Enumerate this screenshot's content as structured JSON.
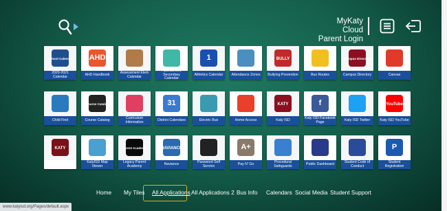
{
  "header": {
    "login_line1": "MyKaty Cloud",
    "login_line2": "Parent Login",
    "icons": [
      "search-icon",
      "hamburger-menu-icon",
      "logout-icon"
    ]
  },
  "tiles": [
    {
      "label": "2020-2021 Calendar",
      "art": "School Calendar",
      "color": "#1e4e8c"
    },
    {
      "label": "AHD Handbook",
      "art": "AHD",
      "color": "#e8572e"
    },
    {
      "label": "Assessment Elem Calendar",
      "art": "",
      "color": "#b07a4a"
    },
    {
      "label": "Assessment Secondary Calendar",
      "art": "",
      "color": "#3fb8a8"
    },
    {
      "label": "Athletics Calendar",
      "art": "1",
      "color": "#1a4fb0"
    },
    {
      "label": "Attendance Zones",
      "art": "",
      "color": "#4a8fc0"
    },
    {
      "label": "Bullying Prevention",
      "art": "BULLY",
      "color": "#c02a2a"
    },
    {
      "label": "Bus Routes",
      "art": "",
      "color": "#f0c020"
    },
    {
      "label": "Campus Directory",
      "art": "Campus Directory",
      "color": "#8a1020"
    },
    {
      "label": "Canvas",
      "art": "",
      "color": "#e03a2a"
    },
    {
      "label": "Child Find",
      "art": "",
      "color": "#2a7ac0"
    },
    {
      "label": "Course Catalog",
      "art": "Course Catalog",
      "color": "#222222"
    },
    {
      "label": "Curriculum Information",
      "art": "",
      "color": "#e04060"
    },
    {
      "label": "District Calendars",
      "art": "31",
      "color": "#3a7ad0"
    },
    {
      "label": "Electric Bus",
      "art": "",
      "color": "#3a9ab0"
    },
    {
      "label": "Home Access",
      "art": "",
      "color": "#e8402a"
    },
    {
      "label": "Katy ISD",
      "art": "KATY",
      "color": "#8a1020"
    },
    {
      "label": "Katy ISD Facebook Page",
      "art": "f",
      "color": "#3b5998"
    },
    {
      "label": "Katy ISD Twitter",
      "art": "",
      "color": "#1da1f2"
    },
    {
      "label": "Katy ISD YouTube",
      "art": "YouTube",
      "color": "#ff0000"
    },
    {
      "label": "",
      "art": "KATY",
      "color": "#7a1018"
    },
    {
      "label": "KatyISD Map Viewer",
      "art": "",
      "color": "#4aa0d0"
    },
    {
      "label": "Legacy Parent Academy",
      "art": "Parent Academy",
      "color": "#0a0a0a"
    },
    {
      "label": "Naviance",
      "art": "NAVIANCE",
      "color": "#2a6ab0"
    },
    {
      "label": "Password Self Service",
      "art": "",
      "color": "#222222"
    },
    {
      "label": "Pay N' Go",
      "art": "A+",
      "color": "#8a7a6a"
    },
    {
      "label": "Procedural Safeguards",
      "art": "",
      "color": "#3a80d0"
    },
    {
      "label": "Public Dashboard",
      "art": "",
      "color": "#2a3a8a"
    },
    {
      "label": "Student Code of Conduct",
      "art": "",
      "color": "#2a4a9a"
    },
    {
      "label": "Student Registration",
      "art": "P",
      "color": "#1a5ab0"
    }
  ],
  "nav": {
    "items": [
      "Home",
      "My Tiles",
      "All Applications",
      "All Applications 2",
      "Bus Info",
      "Calendars",
      "Social Media",
      "Student Support"
    ],
    "active": "All Applications",
    "active_color": "#d9b020"
  },
  "status_url": "www.katyisd.org/Pages/default.aspx",
  "colors": {
    "background": "#15604c",
    "label_bar": "#1a4f9a"
  }
}
